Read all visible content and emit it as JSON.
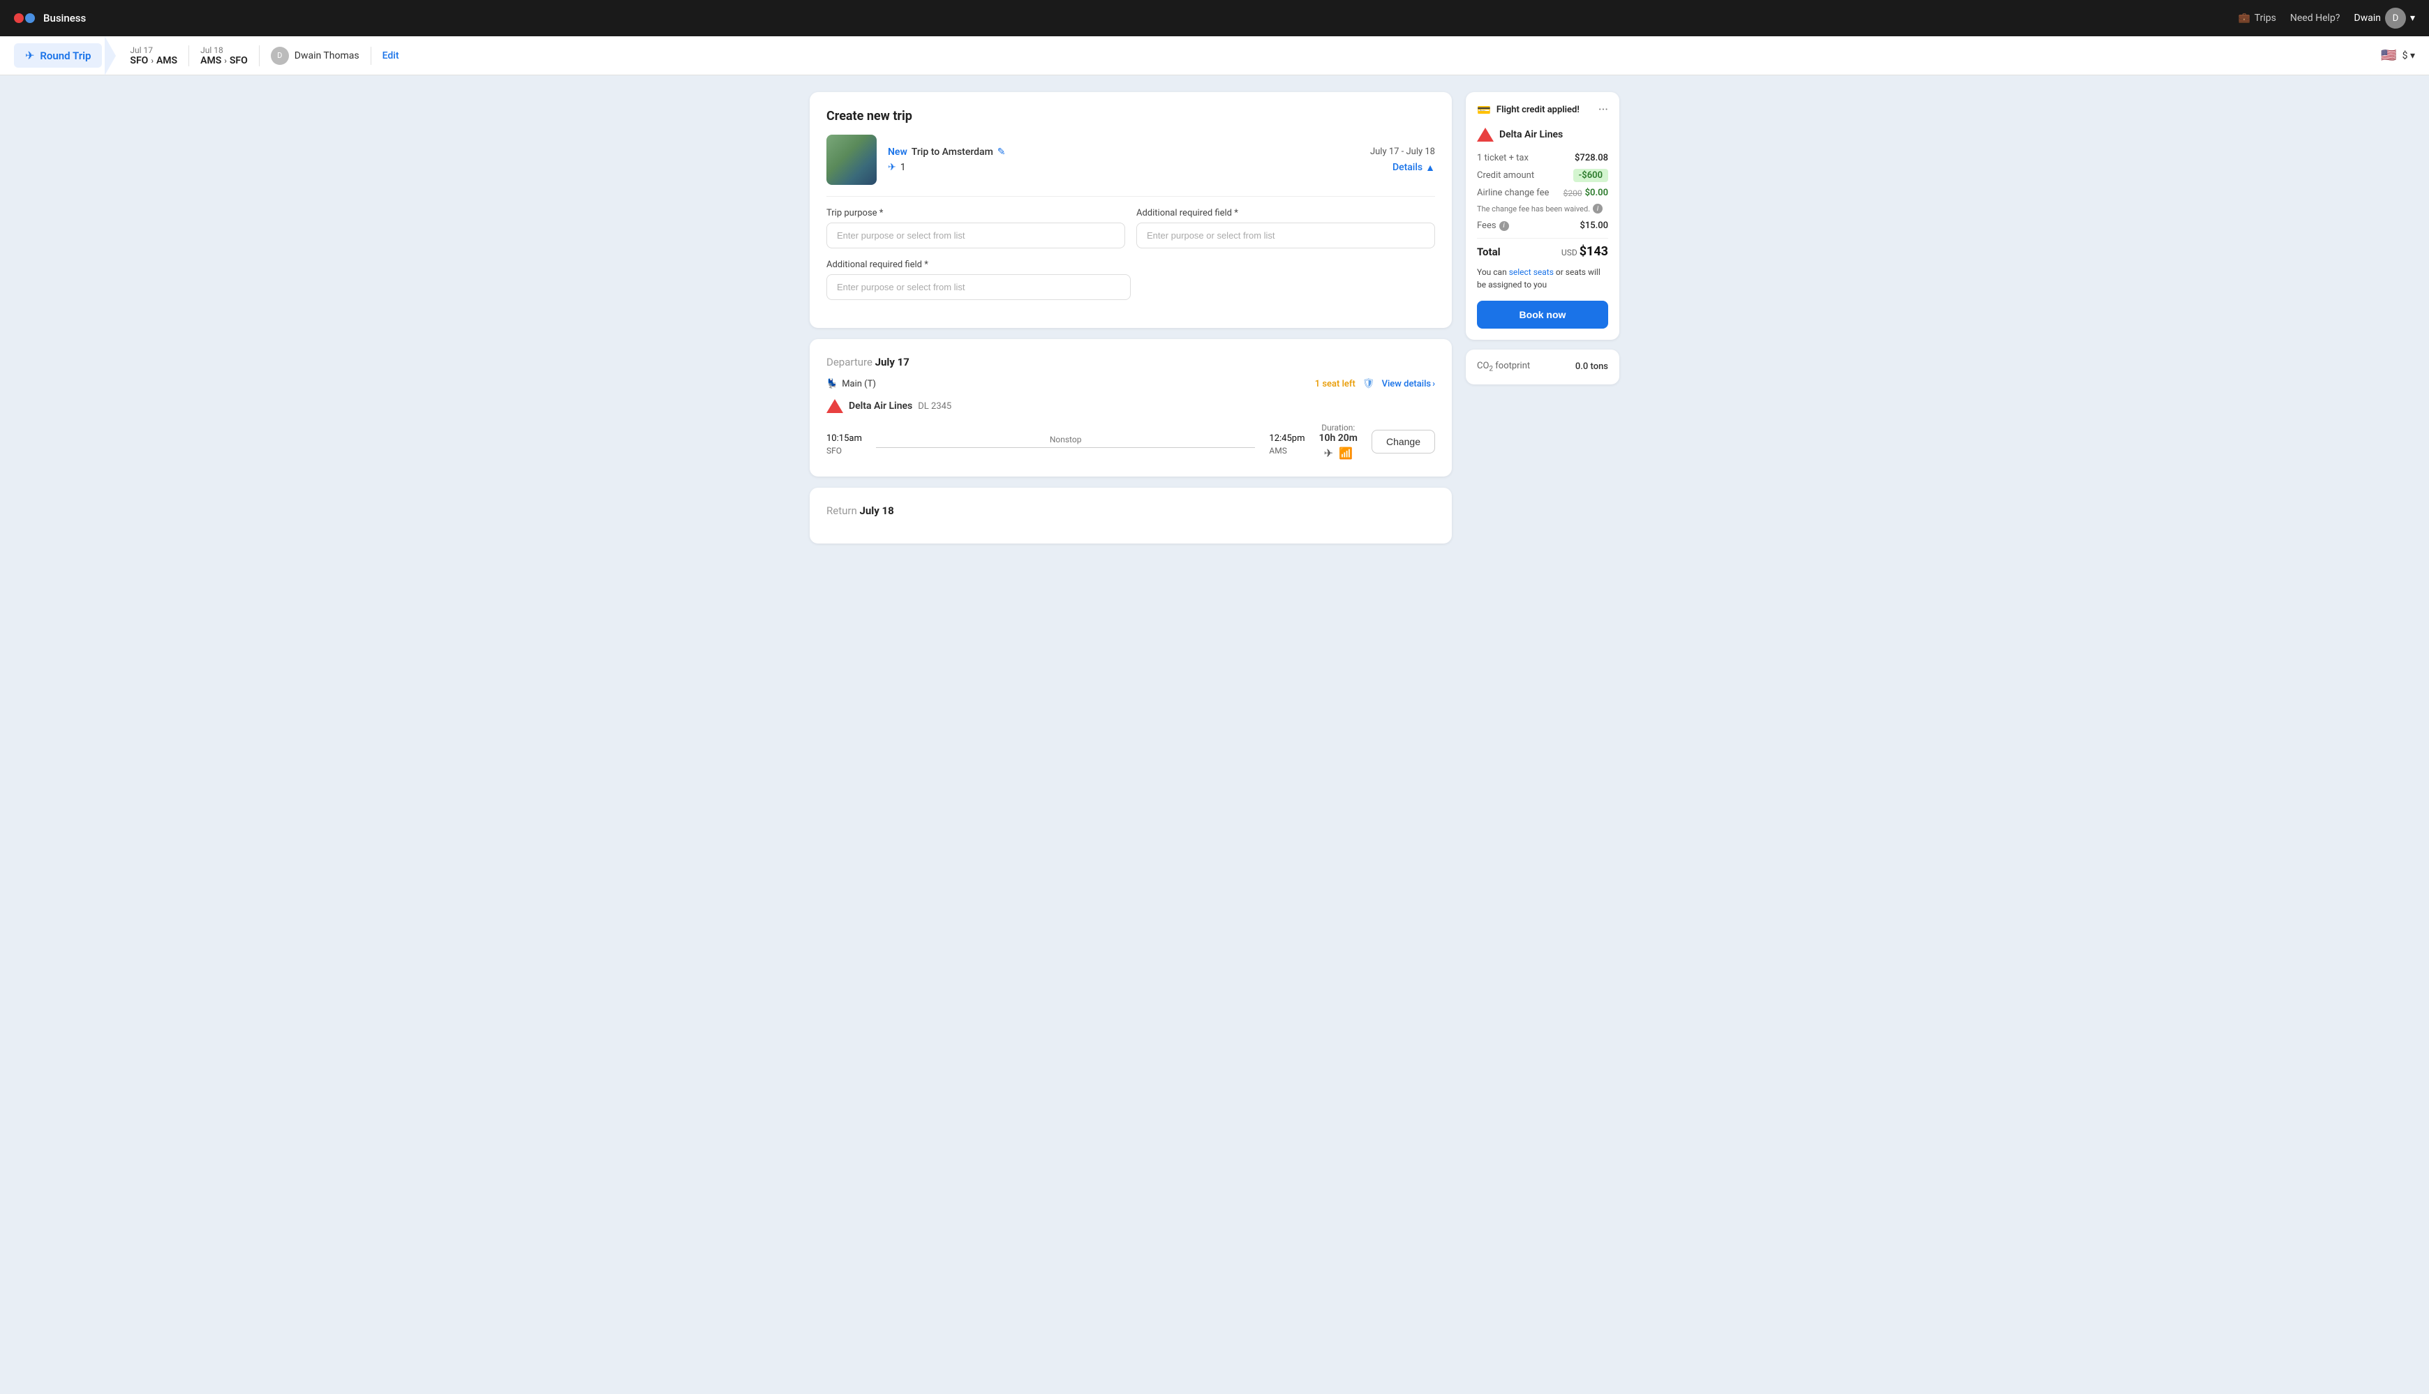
{
  "nav": {
    "brand": "Business",
    "trips_label": "Trips",
    "help_label": "Need Help?",
    "user_name": "Dwain"
  },
  "breadcrumb": {
    "trip_type": "Round Trip",
    "segment1": {
      "date": "Jul 17",
      "from": "SFO",
      "to": "AMS"
    },
    "segment2": {
      "date": "Jul 18",
      "from": "AMS",
      "to": "SFO"
    },
    "traveler": "Dwain Thomas",
    "edit_label": "Edit",
    "currency": "$ ▾"
  },
  "create_trip": {
    "title": "Create new trip",
    "trip_badge": "New",
    "trip_name": "Trip to Amsterdam",
    "trip_dates": "July 17 - July 18",
    "flights_count": "1",
    "details_label": "Details",
    "trip_purpose_label": "Trip purpose *",
    "trip_purpose_placeholder": "Enter purpose or select from list",
    "additional_field1_label": "Additional required field *",
    "additional_field1_placeholder": "Enter purpose or select from list",
    "additional_field2_label": "Additional required field *",
    "additional_field2_placeholder": "Enter purpose or select from list"
  },
  "departure": {
    "label": "Departure",
    "date": "July 17",
    "cabin_class": "Main (T)",
    "seat_warning": "1 seat left",
    "view_details": "View details",
    "airline_name": "Delta Air Lines",
    "flight_number": "DL 2345",
    "depart_time": "10:15",
    "depart_ampm": "am",
    "depart_airport": "SFO",
    "arrive_time": "12:45",
    "arrive_ampm": "pm",
    "arrive_airport": "AMS",
    "nonstop": "Nonstop",
    "duration_label": "Duration:",
    "duration": "10h 20m",
    "change_label": "Change"
  },
  "return": {
    "label": "Return",
    "date": "July 18"
  },
  "sidebar": {
    "credit_title": "Flight credit applied!",
    "airline": "Delta Air Lines",
    "ticket_tax_label": "1 ticket + tax",
    "ticket_tax_value": "$728.08",
    "credit_label": "Credit amount",
    "credit_value": "-$600",
    "change_fee_label": "Airline change fee",
    "change_fee_original": "$200",
    "change_fee_new": "$0.00",
    "fee_note": "The change fee has been waived.",
    "fees_label": "Fees",
    "fees_value": "$15.00",
    "total_label": "Total",
    "total_currency": "USD",
    "total_amount": "$143",
    "seats_note_prefix": "You can ",
    "seats_link": "select seats",
    "seats_note_suffix": " or seats will be assigned to you",
    "book_label": "Book now",
    "co2_label": "CO₂ footprint",
    "co2_value": "0.0 tons"
  }
}
